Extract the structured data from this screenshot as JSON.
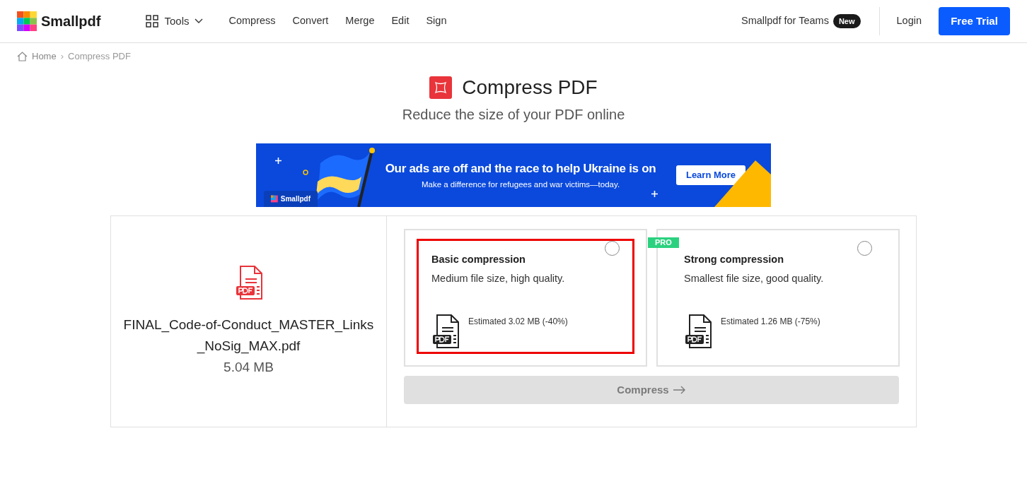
{
  "header": {
    "logo": "Smallpdf",
    "tools_menu": "Tools",
    "nav": [
      "Compress",
      "Convert",
      "Merge",
      "Edit",
      "Sign"
    ],
    "teams_link": "Smallpdf for Teams",
    "teams_badge": "New",
    "login": "Login",
    "trial_button": "Free Trial"
  },
  "breadcrumb": [
    "Home",
    "Compress PDF"
  ],
  "breadcrumb_separator": "›",
  "title": "Compress PDF",
  "subtitle": "Reduce the size of your PDF online",
  "banner": {
    "headline": "Our ads are off and the race to help Ukraine is on",
    "subline": "Make a difference for refugees and war victims—today.",
    "button": "Learn More",
    "brand": "Smallpdf"
  },
  "file": {
    "name": "FINAL_Code-of-Conduct_MASTER_Links_NoSig_MAX.pdf",
    "size": "5.04 MB"
  },
  "options": [
    {
      "title": "Basic compression",
      "description": "Medium file size, high quality.",
      "estimate": "Estimated 3.02 MB (-40%)",
      "selected": false,
      "highlighted": true
    },
    {
      "title": "Strong compression",
      "description": "Smallest file size, good quality.",
      "estimate": "Estimated 1.26 MB (-75%)",
      "badge": "PRO",
      "selected": false,
      "highlighted": false
    }
  ],
  "compress_button": {
    "label": "Compress",
    "disabled": true
  }
}
